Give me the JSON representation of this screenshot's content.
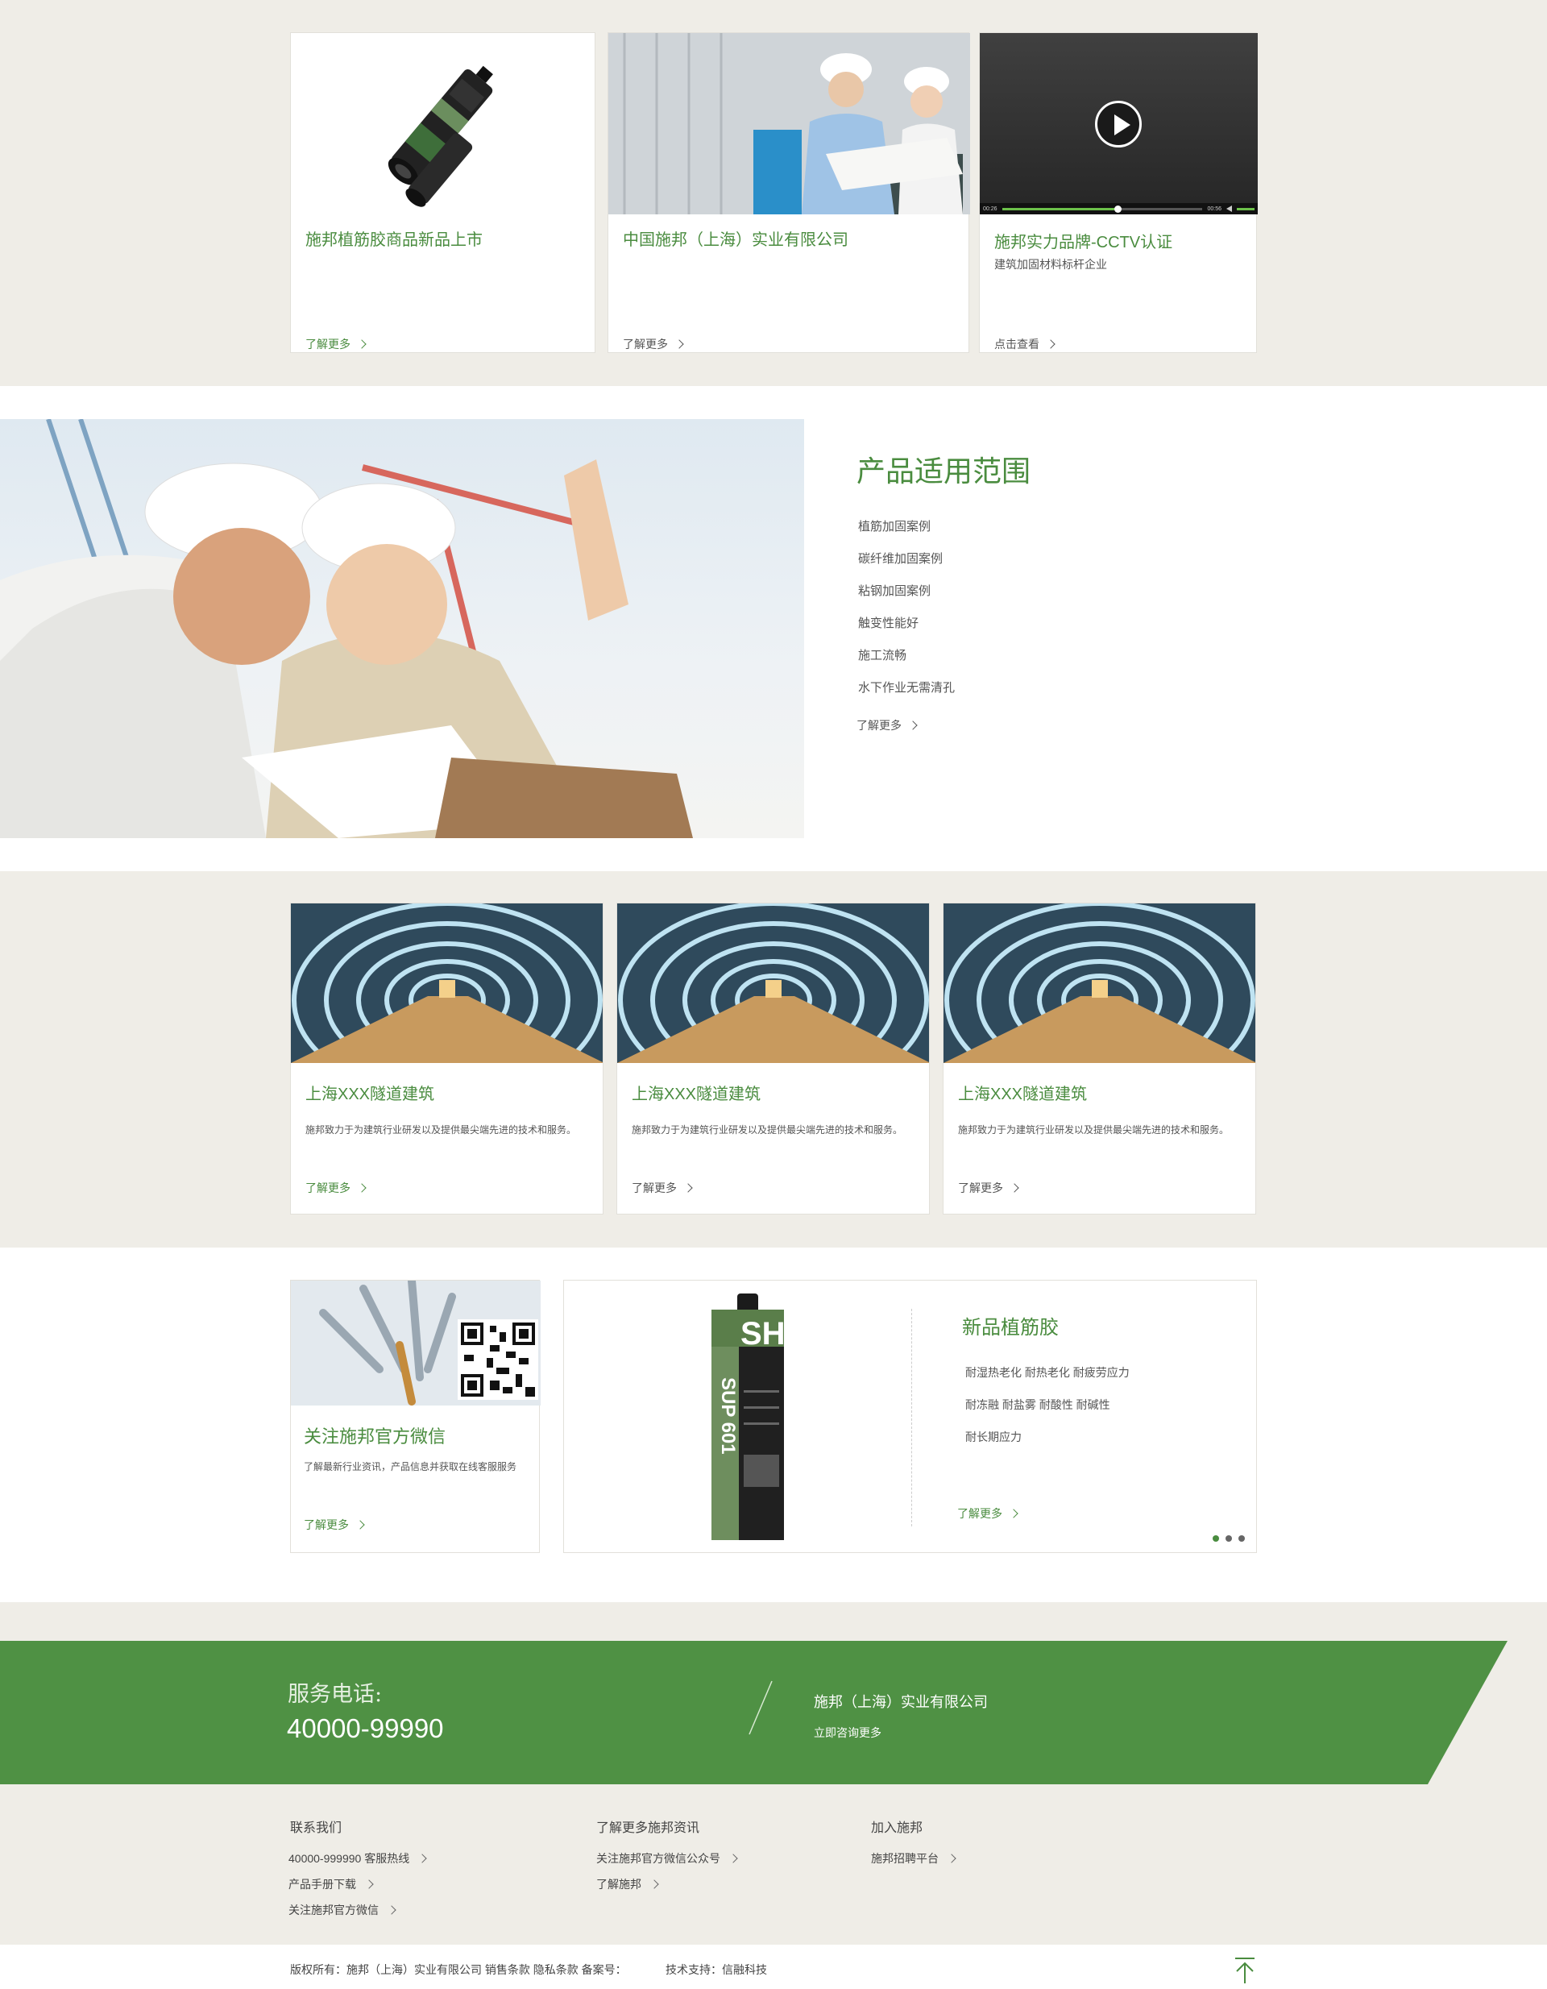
{
  "top_cards": [
    {
      "title": "施邦植筋胶商品新品上市",
      "more": "了解更多"
    },
    {
      "title": "中国施邦（上海）实业有限公司",
      "more": "了解更多"
    },
    {
      "title": "施邦实力品牌-CCTV认证",
      "subtitle": "建筑加固材料标杆企业",
      "more": "点击查看",
      "video": {
        "time_start": "00:26",
        "time_end": "00:56",
        "progress": 0.56
      }
    }
  ],
  "range": {
    "title": "产品适用范围",
    "items": [
      "植筋加固案例",
      "碳纤维加固案例",
      "粘钢加固案例",
      "触变性能好",
      "施工流畅",
      "水下作业无需清孔"
    ],
    "more": "了解更多"
  },
  "tunnels": [
    {
      "title": "上海XXX隧道建筑",
      "desc": "施邦致力于为建筑行业研发以及提供最尖端先进的技术和服务。",
      "more": "了解更多"
    },
    {
      "title": "上海XXX隧道建筑",
      "desc": "施邦致力于为建筑行业研发以及提供最尖端先进的技术和服务。",
      "more": "了解更多"
    },
    {
      "title": "上海XXX隧道建筑",
      "desc": "施邦致力于为建筑行业研发以及提供最尖端先进的技术和服务。",
      "more": "了解更多"
    }
  ],
  "wechat": {
    "title": "关注施邦官方微信",
    "desc": "了解最新行业资讯，产品信息并获取在线客服服务",
    "more": "了解更多"
  },
  "product": {
    "title": "新品植筋胶",
    "lines": [
      "耐湿热老化 耐热老化 耐疲劳应力",
      "耐冻融 耐盐雾 耐酸性 耐碱性",
      "耐长期应力"
    ],
    "more": "了解更多",
    "tube_text_1": "SHI",
    "tube_text_2": "SUP 601",
    "slides": 3,
    "active_slide": 0
  },
  "service": {
    "label": "服务电话:",
    "phone": "40000-99990",
    "company": "施邦（上海）实业有限公司",
    "consult": "立即咨询更多"
  },
  "footer": {
    "col1": {
      "heading": "联系我们",
      "links": [
        "40000-999990  客服热线",
        "产品手册下载",
        "关注施邦官方微信"
      ]
    },
    "col2": {
      "heading": "了解更多施邦资讯",
      "links": [
        "关注施邦官方微信公众号",
        "了解施邦"
      ]
    },
    "col3": {
      "heading": "加入施邦",
      "links": [
        "施邦招聘平台"
      ]
    },
    "copyright": "版权所有：施邦（上海）实业有限公司  销售条款  隐私条款  备案号：",
    "tech": "技术支持：信融科技"
  },
  "colors": {
    "accent": "#4a8c3f",
    "band": "#4f9144",
    "bg": "#efede7"
  }
}
